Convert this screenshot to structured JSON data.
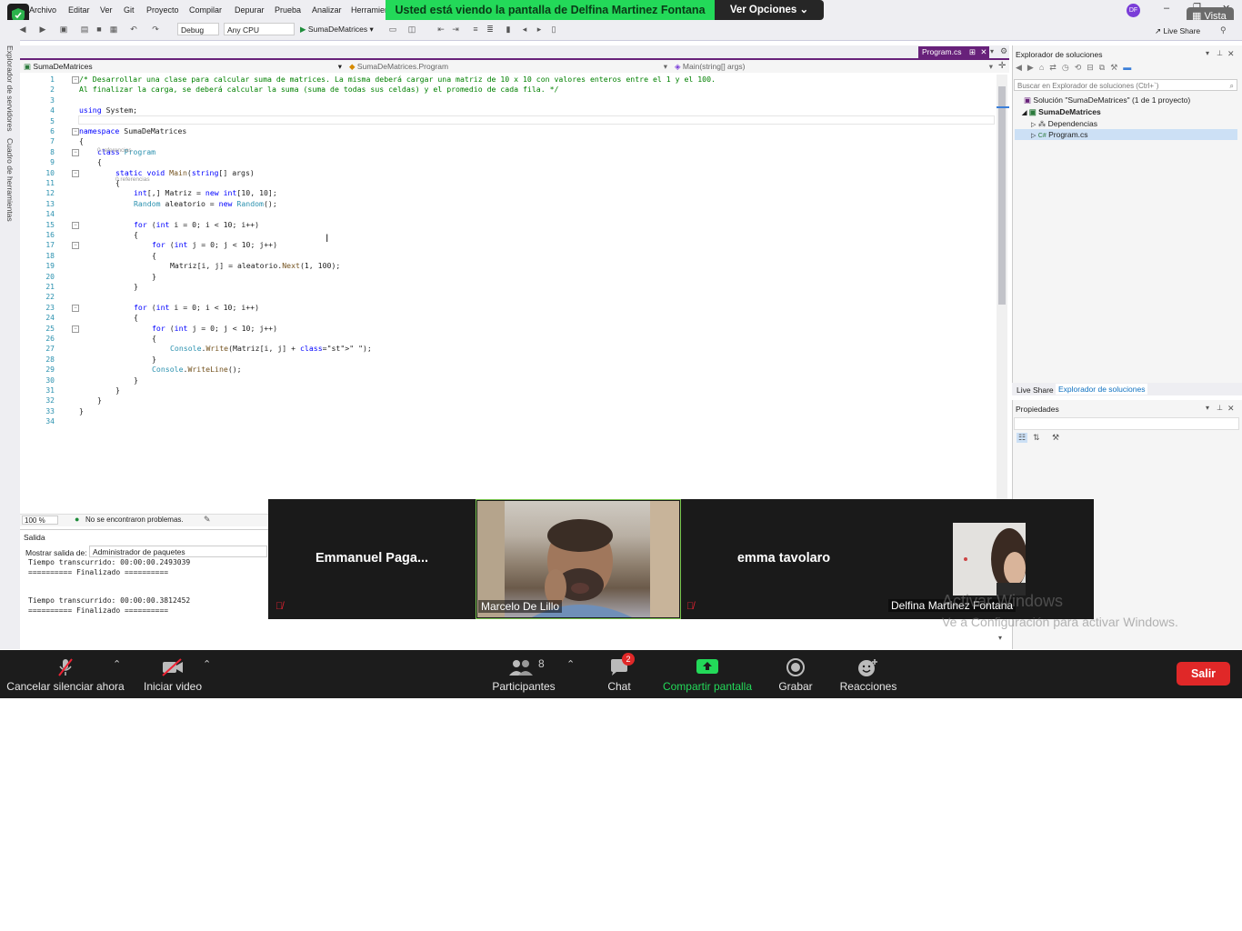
{
  "menu": {
    "items": [
      "Archivo",
      "Editar",
      "Ver",
      "Git",
      "Proyecto",
      "Compilar",
      "Depurar",
      "Prueba",
      "Analizar",
      "Herramien"
    ],
    "vista": "Vista",
    "live_share": "Live Share",
    "avatar": "DF"
  },
  "toolbar": {
    "config": "Debug",
    "platform": "Any CPU",
    "start_target": "SumaDeMatrices"
  },
  "share_banner": {
    "text": "Usted está viendo la pantalla de Delfina Martinez Fontana",
    "view_options": "Ver Opciones"
  },
  "left_tabs": [
    "Explorador de servidores",
    "Cuadro de herramientas"
  ],
  "editor": {
    "file_tab": "Program.cs",
    "nav": {
      "project": "SumaDeMatrices",
      "class": "SumaDeMatrices.Program",
      "member": "Main(string[] args)"
    },
    "references_label": "0 referencias",
    "lines": [
      {
        "n": "1",
        "text": "/* Desarrollar una clase para calcular suma de matrices. La misma deberá cargar una matriz de 10 x 10 con valores enteros entre el 1 y el 100."
      },
      {
        "n": "2",
        "text": "Al finalizar la carga, se deberá calcular la suma (suma de todas sus celdas) y el promedio de cada fila. */"
      },
      {
        "n": "3",
        "text": ""
      },
      {
        "n": "4",
        "text": "using System;"
      },
      {
        "n": "5",
        "text": ""
      },
      {
        "n": "6",
        "text": "namespace SumaDeMatrices"
      },
      {
        "n": "7",
        "text": "{"
      },
      {
        "n": "8",
        "text": "class Program"
      },
      {
        "n": "9",
        "text": "{"
      },
      {
        "n": "10",
        "text": "static void Main(string[] args)"
      },
      {
        "n": "11",
        "text": "{"
      },
      {
        "n": "12",
        "text": "int[,] Matriz = new int[10, 10];"
      },
      {
        "n": "13",
        "text": "Random aleatorio = new Random();"
      },
      {
        "n": "14",
        "text": ""
      },
      {
        "n": "15",
        "text": "for (int i = 0; i < 10; i++)"
      },
      {
        "n": "16",
        "text": "{"
      },
      {
        "n": "17",
        "text": "for (int j = 0; j < 10; j++)"
      },
      {
        "n": "18",
        "text": "{"
      },
      {
        "n": "19",
        "text": "Matriz[i, j] = aleatorio.Next(1, 100);"
      },
      {
        "n": "20",
        "text": "}"
      },
      {
        "n": "21",
        "text": "}"
      },
      {
        "n": "22",
        "text": ""
      },
      {
        "n": "23",
        "text": "for (int i = 0; i < 10; i++)"
      },
      {
        "n": "24",
        "text": "{"
      },
      {
        "n": "25",
        "text": "for (int j = 0; j < 10; j++)"
      },
      {
        "n": "26",
        "text": "{"
      },
      {
        "n": "27",
        "text": "Console.Write(Matriz[i, j] + \" \");"
      },
      {
        "n": "28",
        "text": "}"
      },
      {
        "n": "29",
        "text": "Console.WriteLine();"
      },
      {
        "n": "30",
        "text": "}"
      },
      {
        "n": "31",
        "text": "}"
      },
      {
        "n": "32",
        "text": "}"
      },
      {
        "n": "33",
        "text": "}"
      },
      {
        "n": "34",
        "text": ""
      }
    ],
    "zoom": "100 %",
    "status": "No se encontraron problemas."
  },
  "output": {
    "title": "Salida",
    "show_from_label": "Mostrar salida de:",
    "source": "Administrador de paquetes",
    "lines": [
      "Tiempo transcurrido: 00:00:00.2493039",
      "========== Finalizado ==========",
      "",
      "",
      "Tiempo transcurrido: 00:00:00.3812452",
      "========== Finalizado =========="
    ]
  },
  "solution_explorer": {
    "title": "Explorador de soluciones",
    "search_placeholder": "Buscar en Explorador de soluciones (Ctrl+`)",
    "tree": [
      "Solución \"SumaDeMatrices\" (1 de 1 proyecto)",
      "SumaDeMatrices",
      "Dependencias",
      "Program.cs"
    ],
    "bottom_tabs": [
      "Live Share",
      "Explorador de soluciones"
    ]
  },
  "properties": {
    "title": "Propiedades"
  },
  "participants_video": [
    {
      "name": "Emmanuel  Paga...",
      "muted": true
    },
    {
      "name": "Marcelo De Lillo",
      "muted": false
    },
    {
      "name": "emma tavolaro",
      "muted": true
    },
    {
      "name": "Delfina Martinez Fontana",
      "muted": false
    }
  ],
  "windows_watermark": {
    "title": "Activar Windows",
    "subtitle": "Ve a Configuración para activar Windows."
  },
  "zoom_controls": {
    "unmute": "Cancelar silenciar ahora",
    "video": "Iniciar video",
    "participants": "Participantes",
    "participants_count": "8",
    "chat": "Chat",
    "chat_badge": "2",
    "share": "Compartir pantalla",
    "record": "Grabar",
    "reactions": "Reacciones",
    "leave": "Salir"
  }
}
